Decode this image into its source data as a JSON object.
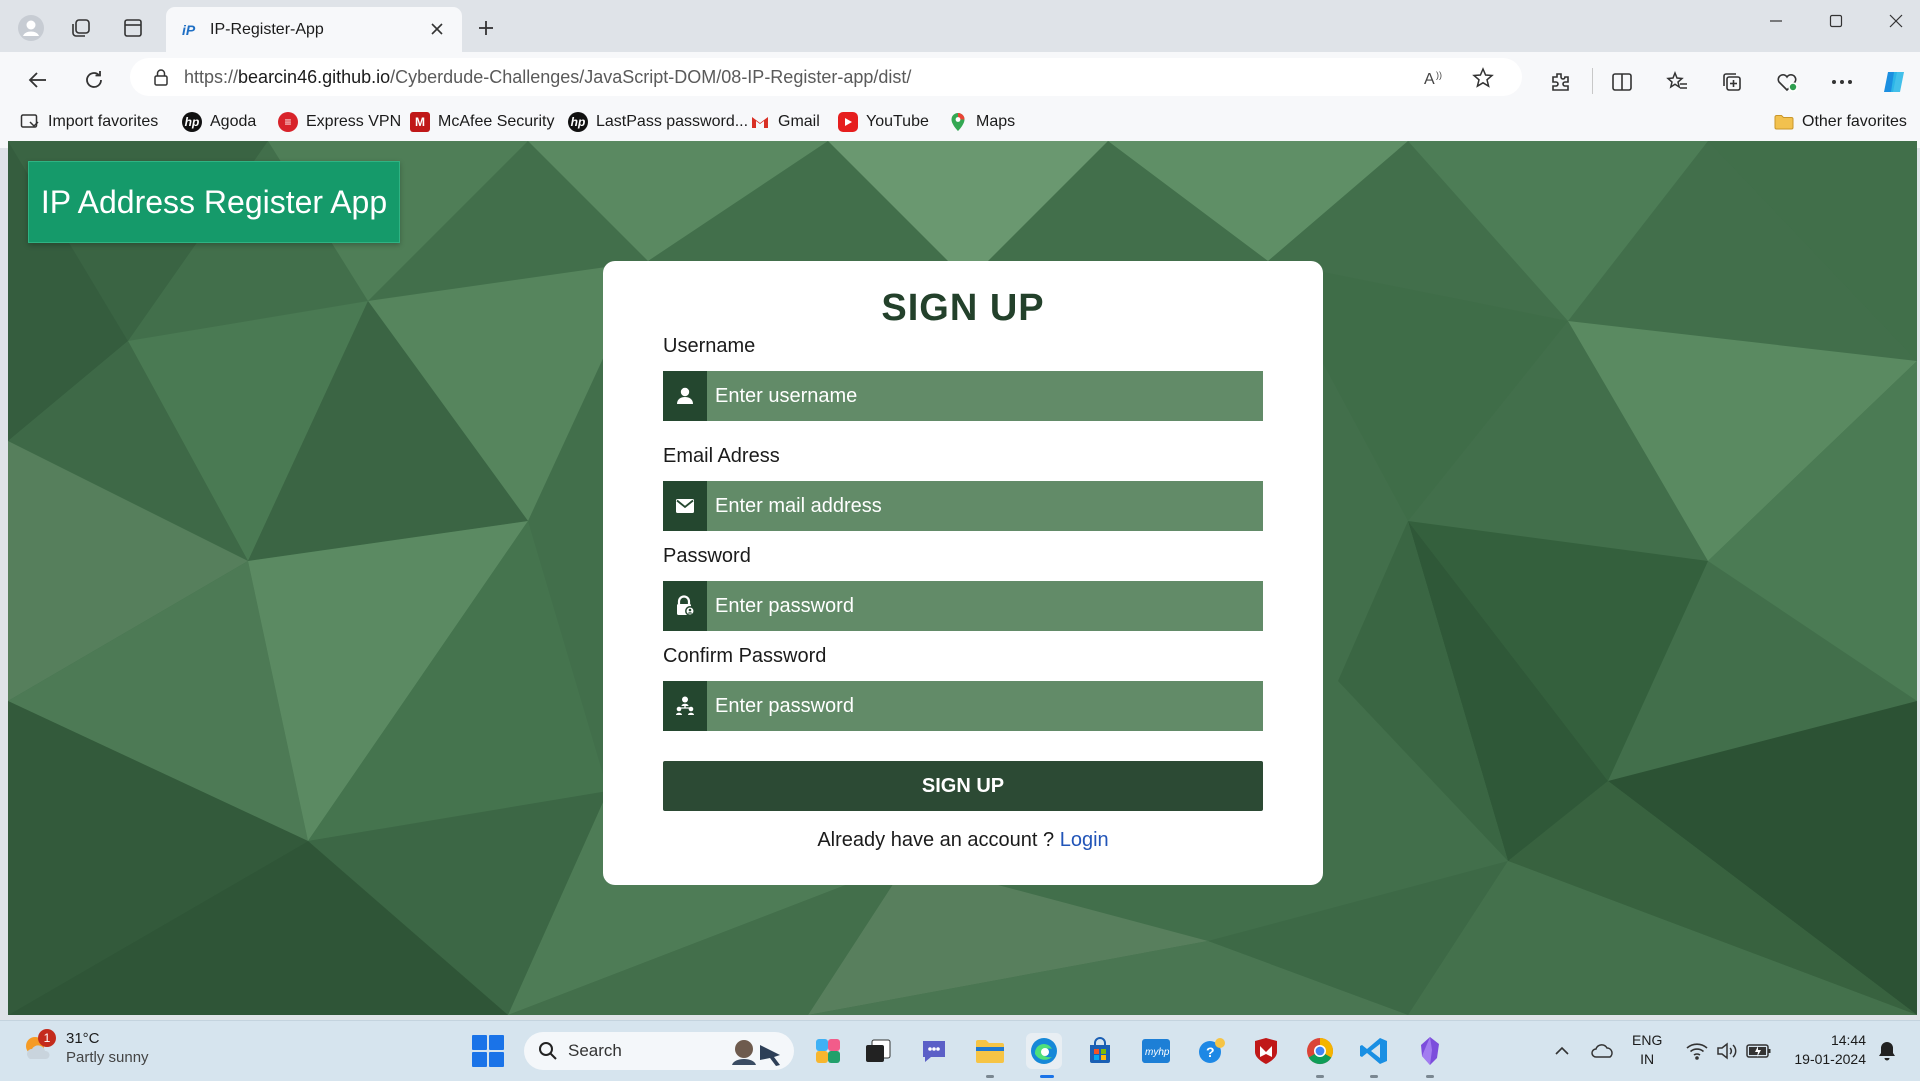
{
  "browser": {
    "tab_title": "IP-Register-App",
    "url_prefix": "https://",
    "url_host": "bearcin46.github.io",
    "url_path": "/Cyberdude-Challenges/JavaScript-DOM/08-IP-Register-app/dist/",
    "favorites": [
      {
        "label": "Import favorites",
        "icon": "import-icon"
      },
      {
        "label": "Agoda",
        "icon": "hp-icon"
      },
      {
        "label": "Express VPN",
        "icon": "expressvpn-icon"
      },
      {
        "label": "McAfee Security",
        "icon": "mcafee-icon"
      },
      {
        "label": "LastPass password...",
        "icon": "hp-icon"
      },
      {
        "label": "Gmail",
        "icon": "gmail-icon"
      },
      {
        "label": "YouTube",
        "icon": "youtube-icon"
      },
      {
        "label": "Maps",
        "icon": "maps-pin-icon"
      }
    ],
    "other_favorites": "Other favorites"
  },
  "app": {
    "brand": "IP Address Register App",
    "form": {
      "title": "SIGN UP",
      "username_label": "Username",
      "username_placeholder": "Enter username",
      "email_label": "Email Adress",
      "email_placeholder": "Enter mail address",
      "password_label": "Password",
      "password_placeholder": "Enter password",
      "confirm_label": "Confirm Password",
      "confirm_placeholder": "Enter password",
      "submit_label": "SIGN UP",
      "login_prompt": "Already have an account ? ",
      "login_link": "Login"
    },
    "colors": {
      "brand_badge": "#159a6a",
      "field_bg": "#628b68",
      "field_icon_bg": "#24472f",
      "button_bg": "#2c4a34",
      "title": "#23412b",
      "link": "#2255b8"
    }
  },
  "taskbar": {
    "weather_temp": "31°C",
    "weather_desc": "Partly sunny",
    "weather_badge": "1",
    "search_label": "Search",
    "lang_1": "ENG",
    "lang_2": "IN",
    "time": "14:44",
    "date": "19-01-2024"
  }
}
